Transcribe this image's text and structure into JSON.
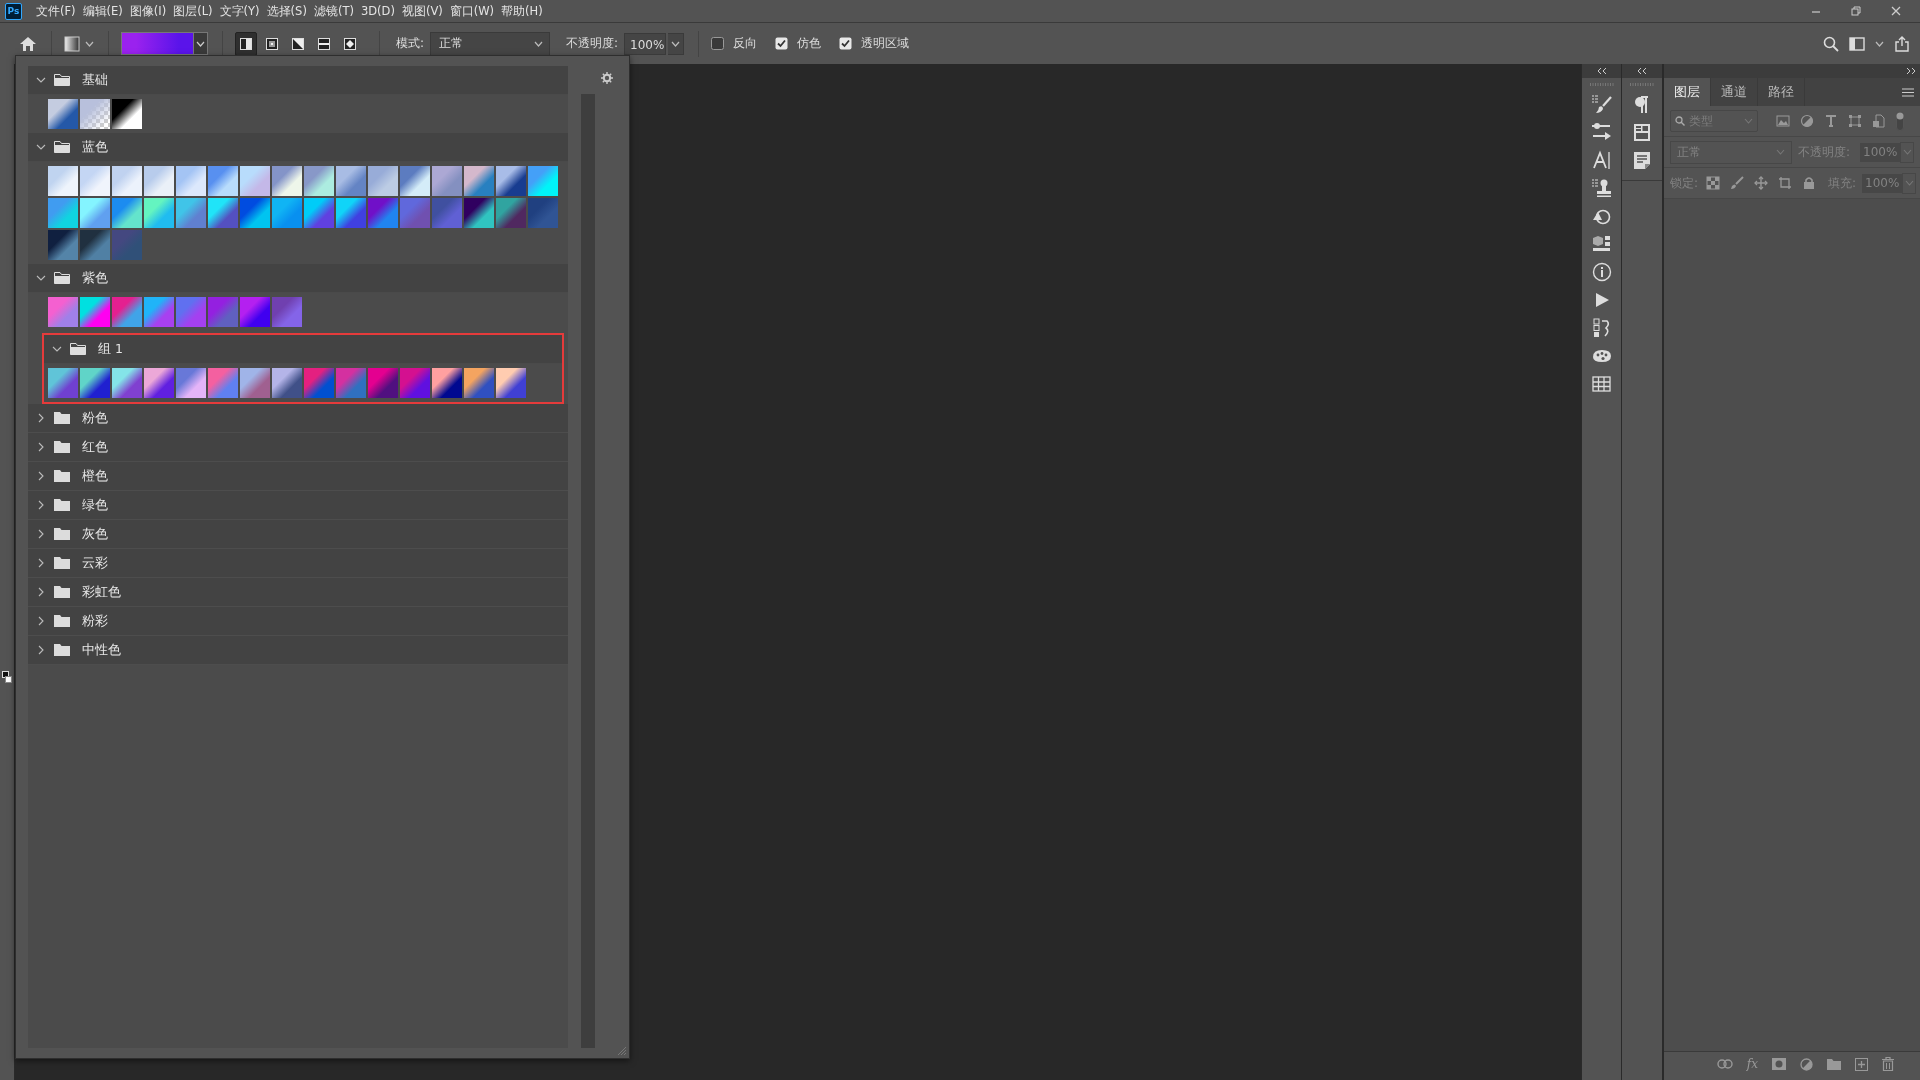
{
  "menu_bar": {
    "logo": "Ps",
    "items": [
      "文件(F)",
      "编辑(E)",
      "图像(I)",
      "图层(L)",
      "文字(Y)",
      "选择(S)",
      "滤镜(T)",
      "3D(D)",
      "视图(V)",
      "窗口(W)",
      "帮助(H)"
    ]
  },
  "options_bar": {
    "gradient": {
      "stops": [
        {
          "color": "#9a22ee"
        },
        {
          "color": "#5a14ea"
        }
      ]
    },
    "gradient_types": [
      {
        "kind": "linear",
        "selected": true
      },
      {
        "kind": "radial",
        "selected": false
      },
      {
        "kind": "angle",
        "selected": false
      },
      {
        "kind": "reflected",
        "selected": false
      },
      {
        "kind": "diamond",
        "selected": false
      }
    ],
    "mode_label": "模式:",
    "mode": "正常",
    "opacity_label": "不透明度:",
    "opacity": "100%",
    "options": [
      {
        "label": "反向",
        "checked": false
      },
      {
        "label": "仿色",
        "checked": true
      },
      {
        "label": "透明区域",
        "checked": true
      }
    ]
  },
  "gradient_picker": {
    "folders": [
      {
        "name": "基础",
        "expanded": true,
        "highlighted": false,
        "swatches": [
          {
            "kind": "gradient",
            "stops": [
              {
                "color": "#c4cce0"
              },
              {
                "color": "#2458a8"
              }
            ]
          },
          {
            "kind": "transparent",
            "stops": [
              {
                "color": "#b8c0dc"
              }
            ]
          },
          {
            "kind": "gradient",
            "stops": [
              {
                "color": "#000000"
              },
              {
                "color": "#ffffff"
              }
            ]
          }
        ]
      },
      {
        "name": "蓝色",
        "expanded": true,
        "highlighted": false,
        "swatches": [
          {
            "kind": "gradient",
            "stops": [
              {
                "color": "#c0d4f0"
              },
              {
                "color": "#eef4fc"
              }
            ]
          },
          {
            "kind": "gradient",
            "stops": [
              {
                "color": "#c4d6f4"
              },
              {
                "color": "#f0f4fc"
              }
            ]
          },
          {
            "kind": "gradient",
            "stops": [
              {
                "color": "#c0d2f0"
              },
              {
                "color": "#ecf2fc"
              }
            ]
          },
          {
            "kind": "gradient",
            "stops": [
              {
                "color": "#b8ccec"
              },
              {
                "color": "#eaf0f8"
              }
            ]
          },
          {
            "kind": "gradient",
            "stops": [
              {
                "color": "#a4c4f4"
              },
              {
                "color": "#dce8fc"
              }
            ]
          },
          {
            "kind": "gradient",
            "stops": [
              {
                "color": "#5890f0"
              },
              {
                "color": "#b8dcfc"
              }
            ]
          },
          {
            "kind": "gradient",
            "stops": [
              {
                "color": "#b8dcfc"
              },
              {
                "color": "#c4b8e8"
              }
            ]
          },
          {
            "kind": "gradient",
            "stops": [
              {
                "color": "#8494c8"
              },
              {
                "color": "#eef6ea"
              }
            ]
          },
          {
            "kind": "gradient",
            "stops": [
              {
                "color": "#8898c8"
              },
              {
                "color": "#acece0"
              }
            ]
          },
          {
            "kind": "gradient",
            "stops": [
              {
                "color": "#a8bce4"
              },
              {
                "color": "#6484c4"
              }
            ]
          },
          {
            "kind": "gradient",
            "stops": [
              {
                "color": "#98acd8"
              },
              {
                "color": "#bccce4"
              }
            ]
          },
          {
            "kind": "gradient",
            "stops": [
              {
                "color": "#5c7cc0"
              },
              {
                "color": "#d4ecf8"
              }
            ]
          },
          {
            "kind": "gradient",
            "stops": [
              {
                "color": "#aca8d4"
              },
              {
                "color": "#8490c0"
              }
            ]
          },
          {
            "kind": "gradient",
            "stops": [
              {
                "color": "#d4b8cc"
              },
              {
                "color": "#2880c0"
              }
            ]
          },
          {
            "kind": "gradient",
            "stops": [
              {
                "color": "#a8bce8"
              },
              {
                "color": "#183c90"
              }
            ]
          },
          {
            "kind": "gradient",
            "stops": [
              {
                "color": "#44a0f8"
              },
              {
                "color": "#00f4f8"
              }
            ]
          },
          {
            "kind": "gradient",
            "stops": [
              {
                "color": "#409cf0"
              },
              {
                "color": "#10d4e0"
              }
            ]
          },
          {
            "kind": "gradient",
            "stops": [
              {
                "color": "#84f4ff"
              },
              {
                "color": "#60a0f0"
              }
            ]
          },
          {
            "kind": "gradient",
            "stops": [
              {
                "color": "#1c8cf0"
              },
              {
                "color": "#64e4cc"
              }
            ]
          },
          {
            "kind": "gradient",
            "stops": [
              {
                "color": "#64f4c0"
              },
              {
                "color": "#20bcf0"
              }
            ]
          },
          {
            "kind": "gradient",
            "stops": [
              {
                "color": "#40c4e8"
              },
              {
                "color": "#6080d0"
              }
            ]
          },
          {
            "kind": "gradient",
            "stops": [
              {
                "color": "#20e4f8"
              },
              {
                "color": "#5450c0"
              }
            ]
          },
          {
            "kind": "gradient",
            "stops": [
              {
                "color": "#004ce0"
              },
              {
                "color": "#00c4f0"
              }
            ]
          },
          {
            "kind": "gradient",
            "stops": [
              {
                "color": "#10b4f4"
              },
              {
                "color": "#0890f0"
              }
            ]
          },
          {
            "kind": "gradient",
            "stops": [
              {
                "color": "#00ccf8"
              },
              {
                "color": "#6040e0"
              }
            ]
          },
          {
            "kind": "gradient",
            "stops": [
              {
                "color": "#10d4f8"
              },
              {
                "color": "#4040e0"
              }
            ]
          },
          {
            "kind": "gradient",
            "stops": [
              {
                "color": "#7010c8"
              },
              {
                "color": "#2084f0"
              }
            ]
          },
          {
            "kind": "gradient",
            "stops": [
              {
                "color": "#6068dc"
              },
              {
                "color": "#7050b0"
              }
            ]
          },
          {
            "kind": "gradient",
            "stops": [
              {
                "color": "#4050a0"
              },
              {
                "color": "#6060d4"
              }
            ]
          },
          {
            "kind": "gradient",
            "stops": [
              {
                "color": "#300060"
              },
              {
                "color": "#30c4c0"
              }
            ]
          },
          {
            "kind": "gradient",
            "stops": [
              {
                "color": "#30a4a0"
              },
              {
                "color": "#502860"
              }
            ]
          },
          {
            "kind": "gradient",
            "stops": [
              {
                "color": "#204080"
              },
              {
                "color": "#305494"
              }
            ]
          },
          {
            "kind": "gradient",
            "stops": [
              {
                "color": "#102040"
              },
              {
                "color": "#5484a8"
              }
            ]
          },
          {
            "kind": "gradient",
            "stops": [
              {
                "color": "#203040"
              },
              {
                "color": "#5080a4"
              }
            ]
          },
          {
            "kind": "gradient",
            "stops": [
              {
                "color": "#444880"
              },
              {
                "color": "#305078"
              }
            ]
          }
        ]
      },
      {
        "name": "紫色",
        "expanded": true,
        "highlighted": false,
        "swatches": [
          {
            "kind": "gradient",
            "stops": [
              {
                "color": "#f460d0"
              },
              {
                "color": "#a080e8"
              }
            ]
          },
          {
            "kind": "gradient",
            "stops": [
              {
                "color": "#00e0e0"
              },
              {
                "color": "#ff00f0"
              }
            ]
          },
          {
            "kind": "gradient",
            "stops": [
              {
                "color": "#e42090"
              },
              {
                "color": "#40a4e8"
              }
            ]
          },
          {
            "kind": "gradient",
            "stops": [
              {
                "color": "#20b4f8"
              },
              {
                "color": "#a840f0"
              }
            ]
          },
          {
            "kind": "gradient",
            "stops": [
              {
                "color": "#6070f0"
              },
              {
                "color": "#a440f0"
              }
            ]
          },
          {
            "kind": "gradient",
            "stops": [
              {
                "color": "#9420e0"
              },
              {
                "color": "#6060c0"
              }
            ]
          },
          {
            "kind": "gradient",
            "stops": [
              {
                "color": "#b420f0"
              },
              {
                "color": "#4000f0"
              }
            ]
          },
          {
            "kind": "gradient",
            "stops": [
              {
                "color": "#7040b0"
              },
              {
                "color": "#8464e8"
              }
            ]
          }
        ],
        "children": [
          {
            "name": "组 1",
            "expanded": true,
            "highlighted": true,
            "swatches": [
              {
                "kind": "gradient",
                "stops": [
                  {
                    "color": "#60c4d8"
                  },
                  {
                    "color": "#7040d0"
                  }
                ]
              },
              {
                "kind": "gradient",
                "stops": [
                  {
                    "color": "#60d4c8"
                  },
                  {
                    "color": "#2020d0"
                  }
                ]
              },
              {
                "kind": "gradient",
                "stops": [
                  {
                    "color": "#84e4e8"
                  },
                  {
                    "color": "#8040d0"
                  }
                ]
              },
              {
                "kind": "gradient",
                "stops": [
                  {
                    "color": "#eca8d8"
                  },
                  {
                    "color": "#6020e0"
                  }
                ]
              },
              {
                "kind": "gradient",
                "stops": [
                  {
                    "color": "#6878d8"
                  },
                  {
                    "color": "#e4b4f8"
                  }
                ]
              },
              {
                "kind": "gradient",
                "stops": [
                  {
                    "color": "#f460a0"
                  },
                  {
                    "color": "#6080f0"
                  }
                ]
              },
              {
                "kind": "gradient",
                "stops": [
                  {
                    "color": "#a0b4e8"
                  },
                  {
                    "color": "#a06090"
                  }
                ]
              },
              {
                "kind": "gradient",
                "stops": [
                  {
                    "color": "#b4b4e8"
                  },
                  {
                    "color": "#405088"
                  }
                ]
              },
              {
                "kind": "gradient",
                "stops": [
                  {
                    "color": "#e42080"
                  },
                  {
                    "color": "#0050d0"
                  }
                ]
              },
              {
                "kind": "gradient",
                "stops": [
                  {
                    "color": "#d430a0"
                  },
                  {
                    "color": "#3070c0"
                  }
                ]
              },
              {
                "kind": "gradient",
                "stops": [
                  {
                    "color": "#e40090"
                  },
                  {
                    "color": "#501080"
                  }
                ]
              },
              {
                "kind": "gradient",
                "stops": [
                  {
                    "color": "#d41090"
                  },
                  {
                    "color": "#6010e0"
                  }
                ]
              },
              {
                "kind": "gradient",
                "stops": [
                  {
                    "color": "#ffa0a0"
                  },
                  {
                    "color": "#000890"
                  }
                ]
              },
              {
                "kind": "gradient",
                "stops": [
                  {
                    "color": "#f4a460"
                  },
                  {
                    "color": "#3050c0"
                  }
                ]
              },
              {
                "kind": "gradient",
                "stops": [
                  {
                    "color": "#ffccb0"
                  },
                  {
                    "color": "#4040d4"
                  }
                ]
              }
            ]
          }
        ]
      },
      {
        "name": "粉色",
        "expanded": false,
        "highlighted": false
      },
      {
        "name": "红色",
        "expanded": false,
        "highlighted": false
      },
      {
        "name": "橙色",
        "expanded": false,
        "highlighted": false
      },
      {
        "name": "绿色",
        "expanded": false,
        "highlighted": false
      },
      {
        "name": "灰色",
        "expanded": false,
        "highlighted": false
      },
      {
        "name": "云彩",
        "expanded": false,
        "highlighted": false
      },
      {
        "name": "彩虹色",
        "expanded": false,
        "highlighted": false
      },
      {
        "name": "粉彩",
        "expanded": false,
        "highlighted": false
      },
      {
        "name": "中性色",
        "expanded": false,
        "highlighted": false
      }
    ]
  },
  "layers_panel": {
    "tabs": [
      {
        "label": "图层",
        "selected": true
      },
      {
        "label": "通道",
        "selected": false
      },
      {
        "label": "路径",
        "selected": false
      }
    ],
    "filter": {
      "placeholder": "类型",
      "on": false
    },
    "disabled": true,
    "blend_mode": "正常",
    "opacity_label": "不透明度:",
    "opacity": "100%",
    "lock_label": "锁定:",
    "fill_label": "填充:",
    "fill": "100%",
    "fx_label": "fx"
  }
}
